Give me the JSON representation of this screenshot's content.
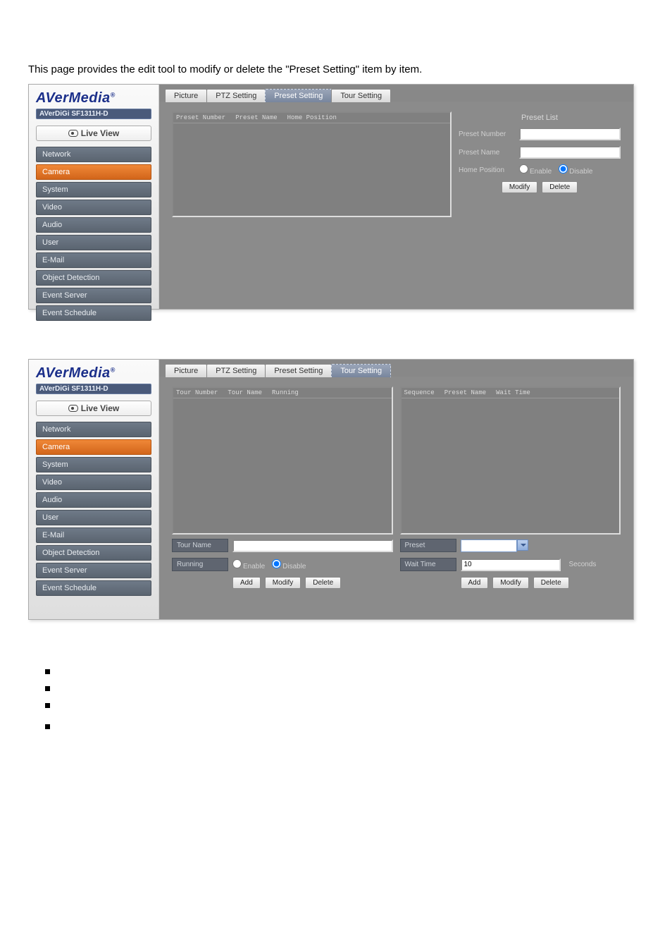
{
  "intro": "This page provides the edit tool to modify or delete the \"Preset Setting\" item by item.",
  "brand": "AVerMedia",
  "subbrand": "AVerDiGi SF1311H-D",
  "liveview": "Live View",
  "nav": {
    "network": "Network",
    "camera": "Camera",
    "system": "System",
    "video": "Video",
    "audio": "Audio",
    "user": "User",
    "email": "E-Mail",
    "objdet": "Object Detection",
    "evserver": "Event Server",
    "evsched": "Event Schedule"
  },
  "tabs": {
    "picture": "Picture",
    "ptz": "PTZ Setting",
    "preset": "Preset Setting",
    "tour": "Tour Setting"
  },
  "preset_panel": {
    "col_preset_number": "Preset Number",
    "col_preset_name": "Preset Name",
    "col_home_pos": "Home Position",
    "side_title": "Preset List",
    "lbl_preset_number": "Preset Number",
    "lbl_preset_name": "Preset Name",
    "lbl_home_position": "Home Position",
    "enable": "Enable",
    "disable": "Disable",
    "modify": "Modify",
    "delete": "Delete"
  },
  "tour_panel": {
    "col_tour_number": "Tour Number",
    "col_tour_name": "Tour Name",
    "col_running": "Running",
    "col_sequence": "Sequence",
    "col_preset_name": "Preset Name",
    "col_wait_time": "Wait Time",
    "lbl_tour_name": "Tour Name",
    "lbl_running": "Running",
    "lbl_preset": "Preset",
    "lbl_wait_time": "Wait Time",
    "wait_time_value": "10",
    "seconds": "Seconds",
    "enable": "Enable",
    "disable": "Disable",
    "add": "Add",
    "modify": "Modify",
    "delete": "Delete"
  }
}
